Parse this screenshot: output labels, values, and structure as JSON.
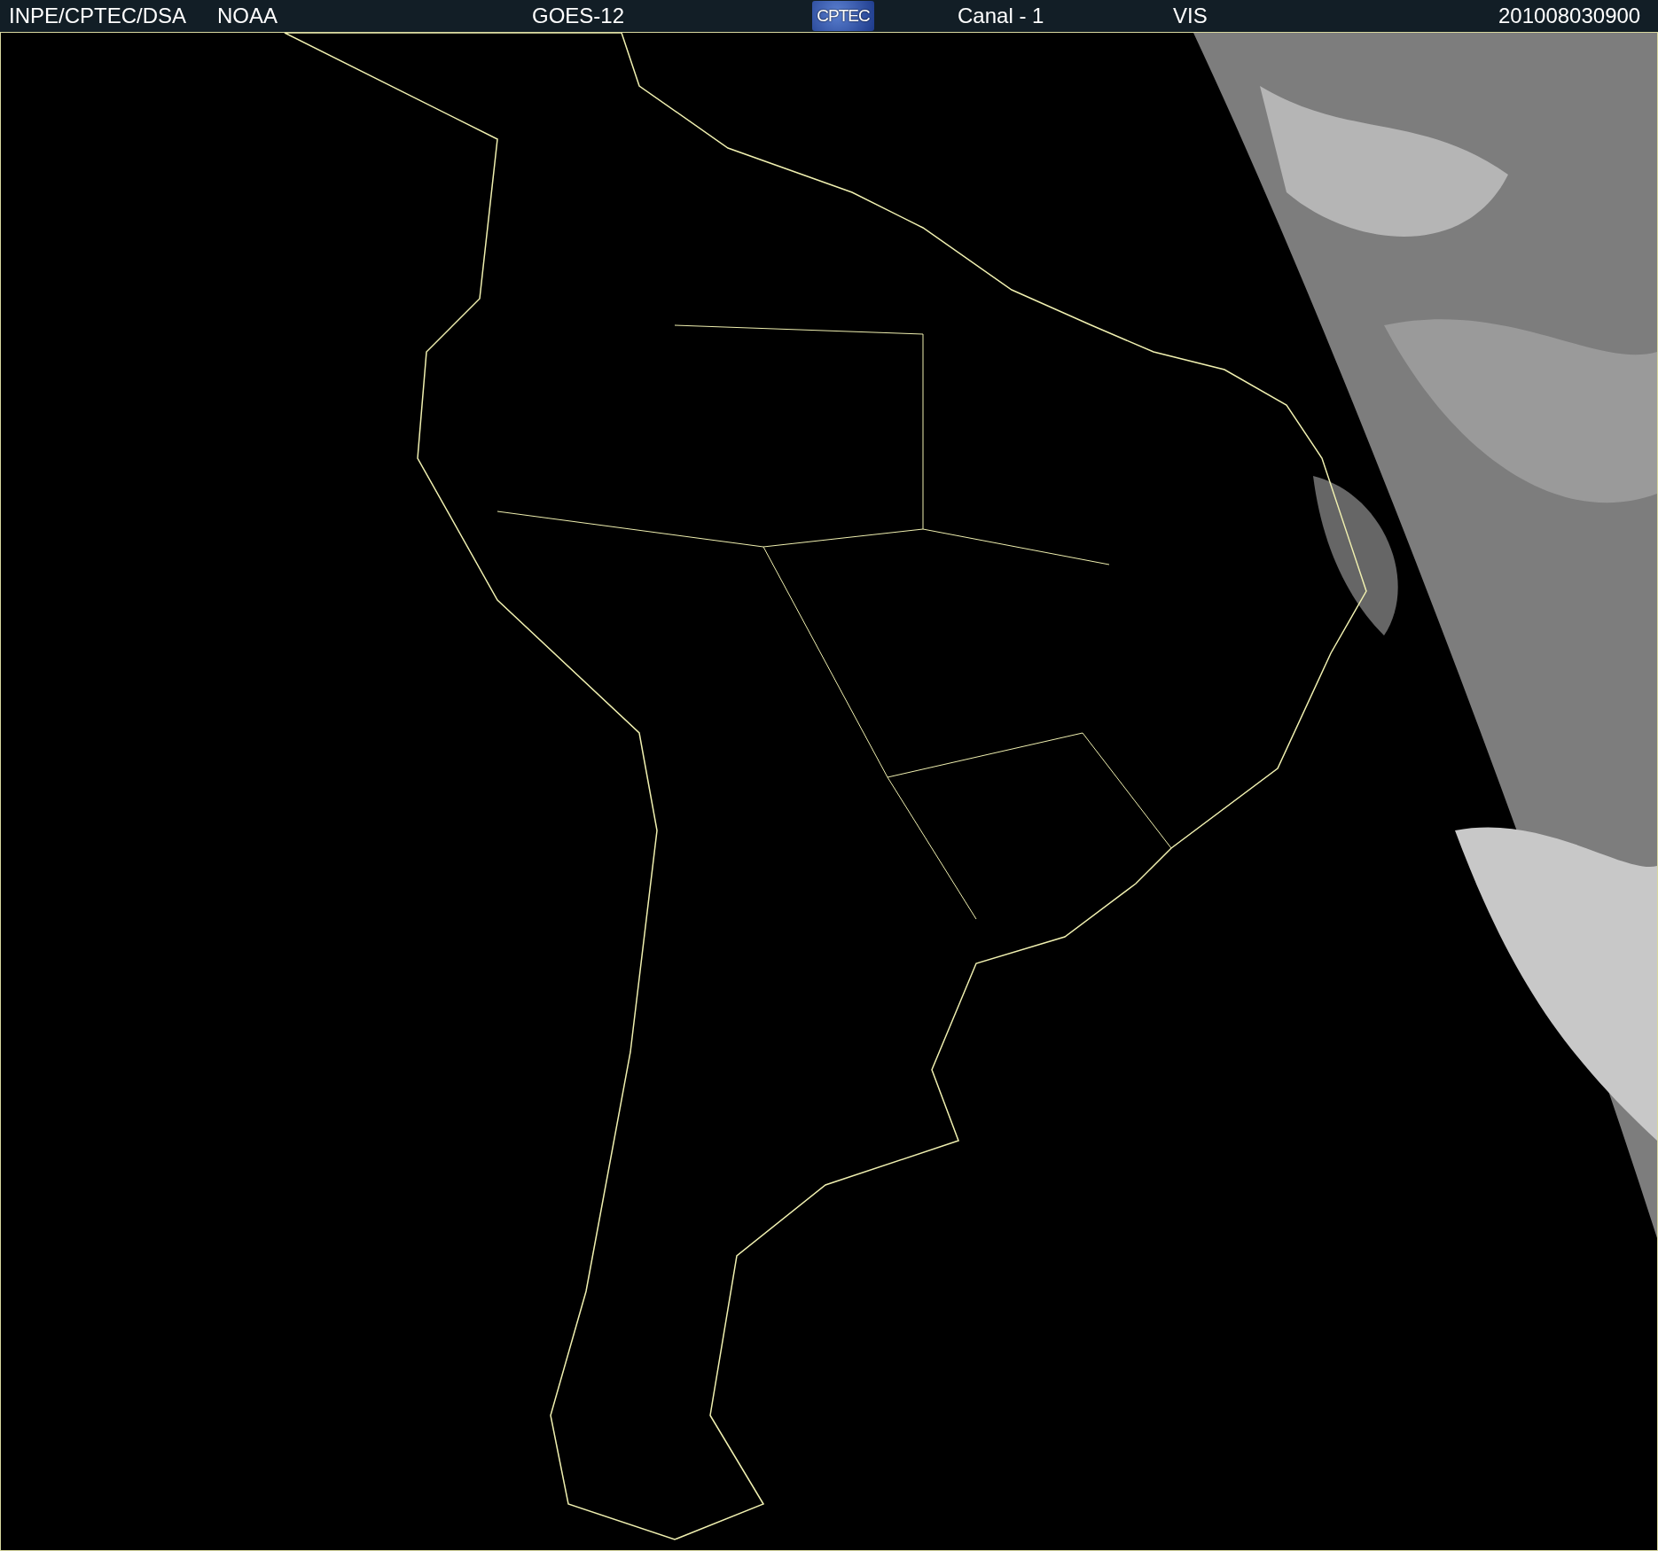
{
  "header": {
    "source": "INPE/CPTEC/DSA",
    "agency": "NOAA",
    "satellite": "GOES-12",
    "logo": "CPTEC",
    "channel": "Canal - 1",
    "band": "VIS",
    "timestamp": "201008030900"
  }
}
